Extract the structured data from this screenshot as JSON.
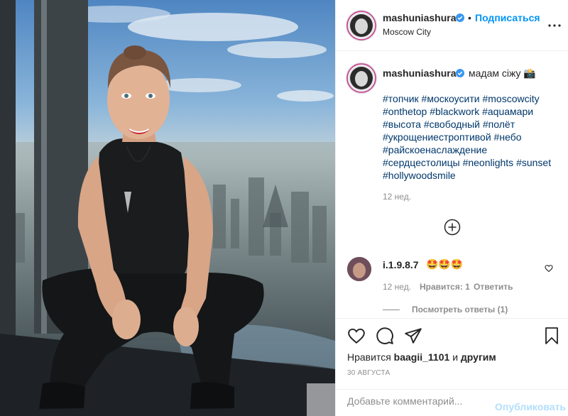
{
  "post": {
    "author": {
      "username": "mashuniashura",
      "verified": true
    },
    "follow_label": "Подписаться",
    "separator": "•",
    "location": "Moscow City",
    "caption": {
      "username": "mashuniashura",
      "text": "мадам сіжу 📸"
    },
    "hashtags": [
      "#топчик",
      "#москоусити",
      "#moscowcity",
      "#onthetop",
      "#blackwork",
      "#aquaмари",
      "#высота",
      "#свободный",
      "#полёт",
      "#укрощениестроптивой",
      "#небо",
      "#райскоенаслаждение",
      "#сердцестолицы",
      "#neonlights",
      "#sunset",
      "#hollywoodsmile"
    ],
    "caption_age": "12 нед.",
    "comments": [
      {
        "username": "i.1.9.8.7",
        "text": "🤩🤩🤩",
        "age": "12 нед.",
        "likes": "Нравится: 1",
        "reply_label": "Ответить",
        "view_replies": "Посмотреть ответы (1)"
      }
    ],
    "likes_prefix": "Нравится",
    "likes_user": "baagii_1101",
    "likes_and": "и",
    "likes_others": "другим",
    "date": "30 АВГУСТА",
    "comment_placeholder": "Добавьте комментарий...",
    "post_label": "Опубликовать"
  },
  "icons": {
    "more": "more-horizontal-icon",
    "verified": "verified-badge-icon",
    "load_more": "plus-circle-icon",
    "comment_like": "heart-small-icon",
    "like": "heart-icon",
    "comment": "comment-bubble-icon",
    "share": "paper-plane-icon",
    "save": "bookmark-icon"
  },
  "colors": {
    "accent": "#0095f6",
    "link": "#00376b",
    "muted": "#8e8e8e",
    "border": "#efefef",
    "post_disabled": "#b2dffc"
  }
}
